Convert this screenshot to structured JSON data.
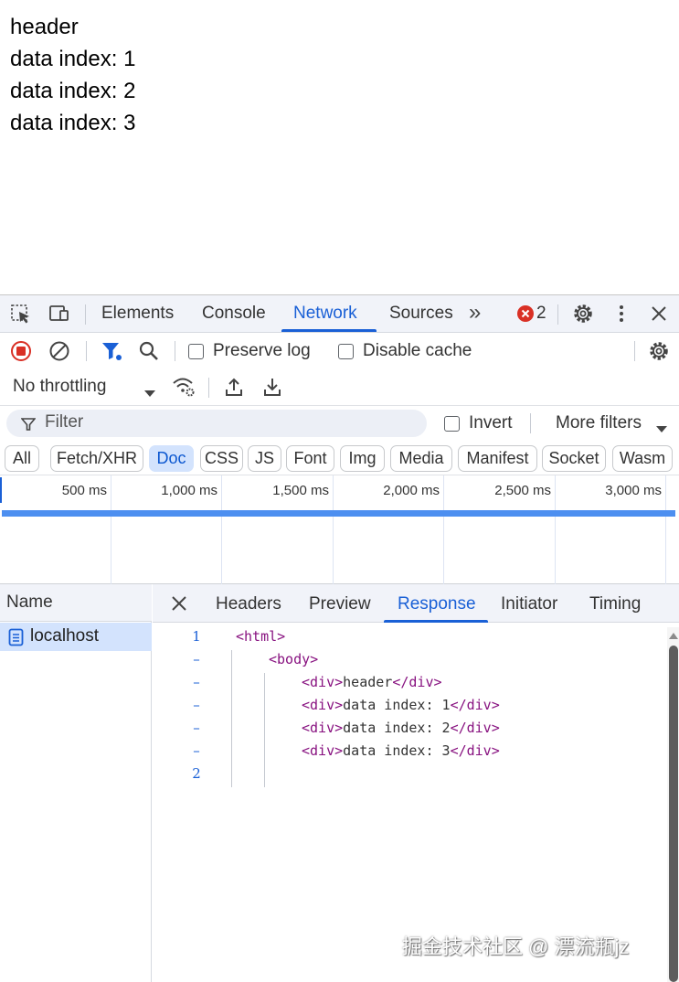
{
  "page": {
    "lines": [
      "header",
      "data index: 1",
      "data index: 2",
      "data index: 3"
    ]
  },
  "devtools": {
    "tabs": [
      "Elements",
      "Console",
      "Network",
      "Sources"
    ],
    "active_tab": "Network",
    "more_tabs": "»",
    "error_count": "2",
    "toolbar": {
      "preserve_log": "Preserve log",
      "disable_cache": "Disable cache",
      "throttling": "No throttling"
    },
    "filter": {
      "placeholder": "Filter",
      "invert": "Invert",
      "more_filters": "More filters"
    },
    "type_filters": [
      "All",
      "Fetch/XHR",
      "Doc",
      "CSS",
      "JS",
      "Font",
      "Img",
      "Media",
      "Manifest",
      "Socket",
      "Wasm"
    ],
    "active_type": "Doc",
    "timeline_ticks": [
      "500 ms",
      "1,000 ms",
      "1,500 ms",
      "2,000 ms",
      "2,500 ms",
      "3,000 ms"
    ],
    "requests": {
      "column": "Name",
      "items": [
        "localhost"
      ]
    },
    "detail": {
      "tabs": [
        "Headers",
        "Preview",
        "Response",
        "Initiator",
        "Timing"
      ],
      "active_tab": "Response",
      "line_numbers": [
        "1",
        "–",
        "–",
        "–",
        "–",
        "–",
        "2"
      ],
      "code": {
        "html_open": "<html>",
        "body_open": "<body>",
        "div_open": "<div>",
        "div_close": "</div>",
        "line1_text": "header",
        "line2_text": "data index: 1",
        "line3_text": "data index: 2",
        "line4_text": "data index: 3"
      }
    }
  },
  "watermark": "掘金技术社区 @ 漂流瓶jz",
  "colors": {
    "accent": "#1a60d6",
    "record": "#d93025",
    "tag": "#881280",
    "selected": "#d3e3fd"
  }
}
